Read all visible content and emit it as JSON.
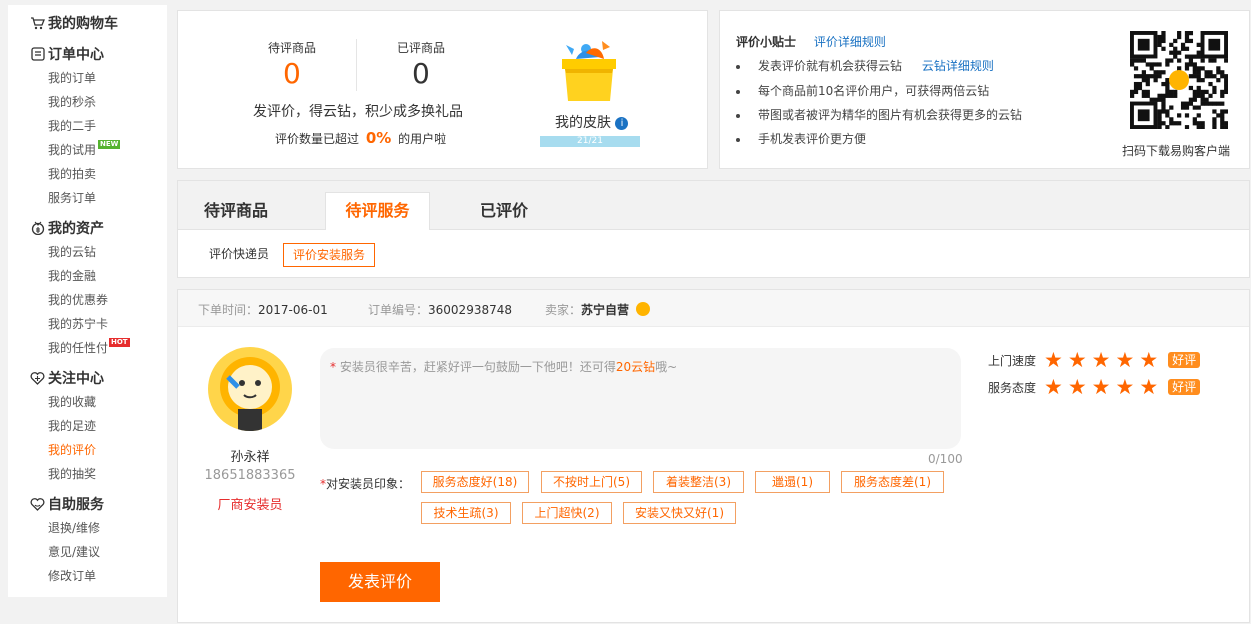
{
  "sidebar": {
    "groups": [
      {
        "title": "我的购物车",
        "icon": "cart-icon",
        "items": []
      },
      {
        "title": "订单中心",
        "icon": "list-icon",
        "items": [
          "我的订单",
          "我的秒杀",
          "我的二手",
          "我的试用",
          "我的拍卖",
          "服务订单"
        ]
      },
      {
        "title": "我的资产",
        "icon": "wallet-icon",
        "items": [
          "我的云钻",
          "我的金融",
          "我的优惠券",
          "我的苏宁卡",
          "我的任性付"
        ]
      },
      {
        "title": "关注中心",
        "icon": "heart-icon",
        "items": [
          "我的收藏",
          "我的足迹",
          "我的评价",
          "我的抽奖"
        ]
      },
      {
        "title": "自助服务",
        "icon": "service-icon",
        "items": [
          "退换/维修",
          "意见/建议",
          "修改订单"
        ]
      }
    ],
    "badges": {
      "new": "NEW",
      "hot": "HOT"
    }
  },
  "stats": {
    "pending_label": "待评商品",
    "pending_count": "0",
    "done_label": "已评商品",
    "done_count": "0",
    "slogan": "发评价，得云钻，积少成多换礼品",
    "exceed_prefix": "评价数量已超过",
    "exceed_pct": "0%",
    "exceed_suffix": "的用户啦",
    "skin_label": "我的皮肤",
    "skin_progress": "21/21",
    "skin_fraction": 1.0
  },
  "tips": {
    "title": "评价小贴士",
    "rules_link": "评价详细规则",
    "lines": [
      {
        "text": "发表评价就有机会获得云钻",
        "link": "云钻详细规则"
      },
      {
        "text": "每个商品前10名评价用户，可获得两倍云钻",
        "link": ""
      },
      {
        "text": "带图或者被评为精华的图片有机会获得更多的云钻",
        "link": ""
      },
      {
        "text": "手机发表评价更方便",
        "link": ""
      }
    ],
    "qr_caption": "扫码下载易购客户端"
  },
  "tabs": {
    "items": [
      "待评商品",
      "待评服务",
      "已评价"
    ],
    "active": 1,
    "subtabs": [
      "评价快递员",
      "评价安装服务"
    ],
    "active_sub": 1
  },
  "order": {
    "date_label": "下单时间：",
    "date": "2017-06-01",
    "no_label": "订单编号：",
    "no": "36002938748",
    "seller_label": "卖家：",
    "seller": "苏宁自营",
    "installer_name": "孙永祥",
    "installer_phone": "18651883365",
    "installer_role": "厂商安装员",
    "placeholder_pre": "安装员很辛苦，赶紧好评一句鼓励一下他吧！还可得",
    "placeholder_hl": "20云钻",
    "placeholder_post": "哦~",
    "char_count": "0/100",
    "impression_label": "对安装员印象：",
    "tags_row1": [
      "服务态度好(18)",
      "不按时上门(5)",
      "着装整洁(3)",
      "邋遢(1)",
      "服务态度差(1)"
    ],
    "tags_row2": [
      "技术生疏(3)",
      "上门超快(2)",
      "安装又快又好(1)"
    ],
    "ratings": [
      {
        "label": "上门速度",
        "stars": 5,
        "verdict": "好评"
      },
      {
        "label": "服务态度",
        "stars": 5,
        "verdict": "好评"
      }
    ],
    "submit_label": "发表评价"
  },
  "colors": {
    "accent": "#ff6600",
    "link": "#1a72c3",
    "skin_bar": "#a7dcef",
    "star": "#ff6600"
  }
}
